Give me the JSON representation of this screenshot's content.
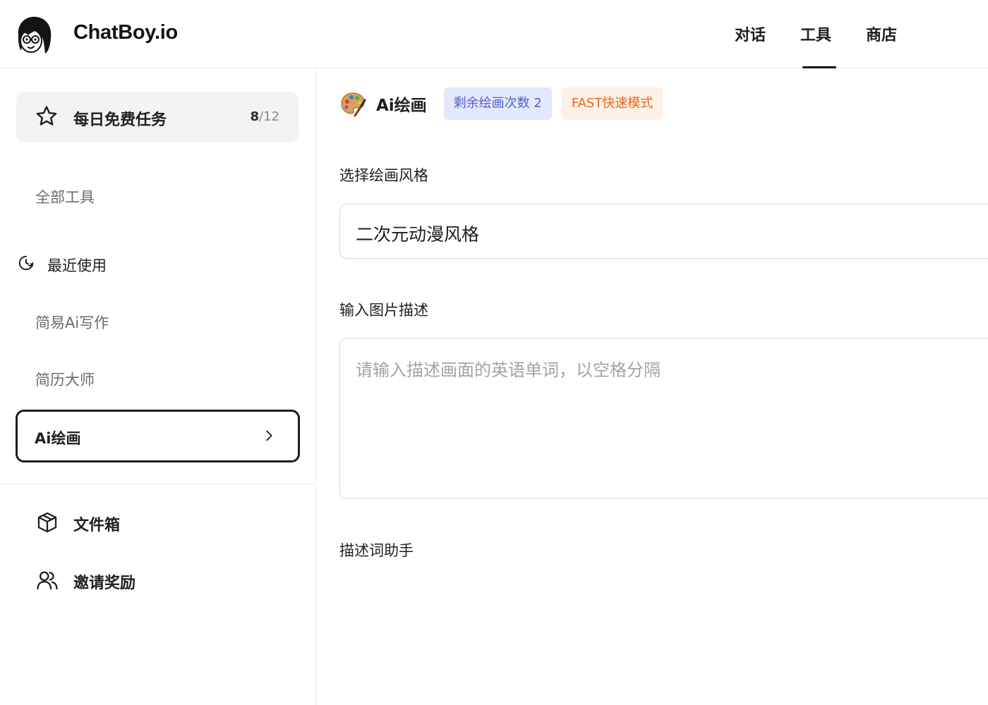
{
  "header": {
    "brand": "ChatBoy.io",
    "nav": [
      {
        "label": "对话"
      },
      {
        "label": "工具"
      },
      {
        "label": "商店"
      }
    ],
    "active_nav": "工具"
  },
  "sidebar": {
    "daily_task": {
      "label": "每日免费任务",
      "done": "8",
      "total": "/12"
    },
    "all_tools": "全部工具",
    "recent_heading": "最近使用",
    "recent_items": [
      {
        "label": "简易Ai写作"
      },
      {
        "label": "简历大师"
      }
    ],
    "active_item": "Ai绘画",
    "bottom_items": [
      {
        "label": "文件箱",
        "icon": "box-icon"
      },
      {
        "label": "邀请奖励",
        "icon": "users-icon"
      }
    ]
  },
  "main": {
    "tool_title": "Ai绘画",
    "tool_icon": "palette-icon",
    "remaining_badge": "剩余绘画次数 2",
    "mode_badge": "FAST快速模式",
    "style_label": "选择绘画风格",
    "style_value": "二次元动漫风格",
    "desc_label": "输入图片描述",
    "desc_placeholder": "请输入描述画面的英语单词，以空格分隔",
    "helper_label": "描述词助手"
  },
  "colors": {
    "badge_blue_bg": "#e4e8fb",
    "badge_blue_text": "#5060c8",
    "badge_orange_bg": "#fdf0e6",
    "badge_orange_text": "#e56a1f",
    "active_border": "#1e1e1e"
  }
}
